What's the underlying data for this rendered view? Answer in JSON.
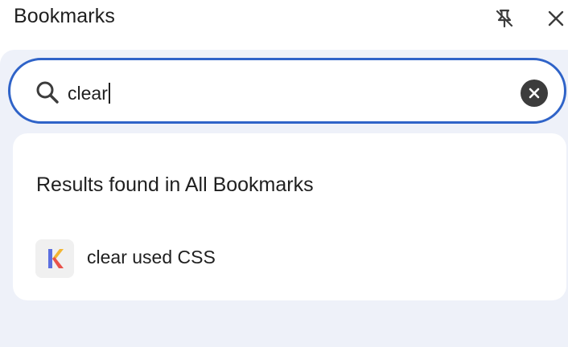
{
  "header": {
    "title": "Bookmarks",
    "pin_icon": "unpin-icon",
    "close_icon": "close-icon"
  },
  "search": {
    "value": "clear",
    "icon": "search-icon",
    "clear_icon": "clear-circle-icon",
    "accent_color": "#2f63c8"
  },
  "results": {
    "heading": "Results found in All Bookmarks",
    "items": [
      {
        "title": "clear used CSS",
        "favicon": "k-logo-icon"
      }
    ]
  },
  "colors": {
    "panel_background": "#eef1f9",
    "card_background": "#ffffff",
    "text": "#1f1f1f"
  }
}
